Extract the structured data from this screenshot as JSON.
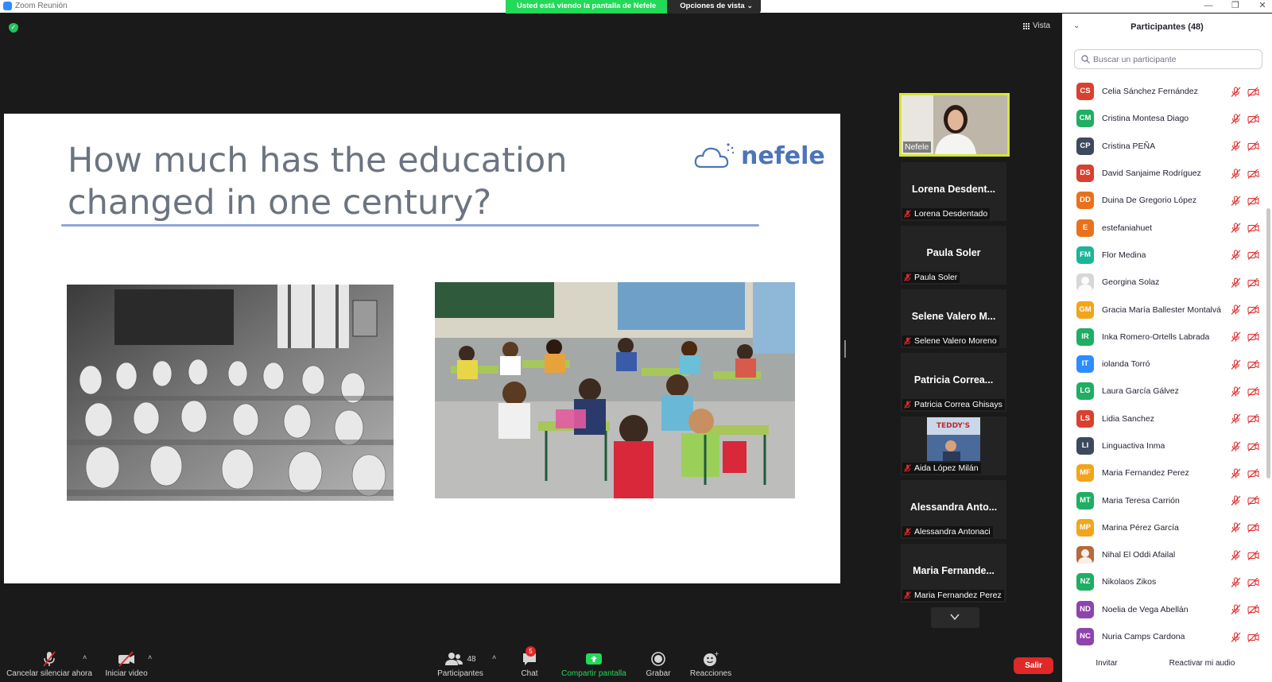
{
  "window": {
    "title": "Zoom Reunión",
    "controls": [
      "minimize",
      "restore",
      "close"
    ]
  },
  "share_banner": {
    "viewing_text": "Usted está viendo la pantalla de Nefele",
    "options_label": "Opciones de vista"
  },
  "view_button": {
    "label": "Vista"
  },
  "slide": {
    "title_line1": "How much has the education",
    "title_line2": "changed in one century?",
    "logo_text": "nefele"
  },
  "video_tiles": [
    {
      "big_name": "",
      "label": "Nefele",
      "has_video": true,
      "active_speaker": true
    },
    {
      "big_name": "Lorena Desdent...",
      "label": "Lorena Desdentado"
    },
    {
      "big_name": "Paula Soler",
      "label": "Paula Soler"
    },
    {
      "big_name": "Selene Valero M...",
      "label": "Selene Valero Moreno"
    },
    {
      "big_name": "Patricia Correa...",
      "label": "Patricia Correa Ghisays"
    },
    {
      "big_name": "",
      "label": "Aida López Milán",
      "has_video": true,
      "video_sign_text": "TEDDY'S"
    },
    {
      "big_name": "Alessandra Anto...",
      "label": "Alessandra Antonaci"
    },
    {
      "big_name": "Maria Fernande...",
      "label": "Maria Fernandez Perez"
    }
  ],
  "toolbar": {
    "unmute": "Cancelar silenciar ahora",
    "start_video": "Iniciar video",
    "participants": "Participantes",
    "participants_count": "48",
    "chat": "Chat",
    "chat_badge": "5",
    "share_screen": "Compartir pantalla",
    "record": "Grabar",
    "reactions": "Reacciones",
    "leave": "Salir"
  },
  "panel": {
    "title": "Participantes (48)",
    "search_placeholder": "Buscar un participante",
    "invite": "Invitar",
    "reactivate_audio": "Reactivar mi audio",
    "participants": [
      {
        "initials": "CS",
        "name": "Celia Sánchez Fernández",
        "color": "#d9402f"
      },
      {
        "initials": "CM",
        "name": "Cristina Montesa Diago",
        "color": "#1fae63"
      },
      {
        "initials": "CP",
        "name": "Cristina PEÑA",
        "color": "#3c4a5c"
      },
      {
        "initials": "DS",
        "name": "David Sanjaime Rodríguez",
        "color": "#d9402f"
      },
      {
        "initials": "DD",
        "name": "Duina De Gregorio López",
        "color": "#e8721b"
      },
      {
        "initials": "E",
        "name": "estefaniahuet",
        "color": "#e8721b"
      },
      {
        "initials": "FM",
        "name": "Flor Medina",
        "color": "#1cb598"
      },
      {
        "initials": "",
        "name": "Georgina Solaz",
        "color": "#d7d7d7",
        "photo": true
      },
      {
        "initials": "GM",
        "name": "Gracia María Ballester Montalvá",
        "color": "#f2a51c"
      },
      {
        "initials": "IR",
        "name": "Inka Romero-Ortells Labrada",
        "color": "#1fae63"
      },
      {
        "initials": "IT",
        "name": "iolanda Torró",
        "color": "#2d8cff"
      },
      {
        "initials": "LG",
        "name": "Laura García Gálvez",
        "color": "#1fae63"
      },
      {
        "initials": "LS",
        "name": "Lidia Sanchez",
        "color": "#d9402f"
      },
      {
        "initials": "LI",
        "name": "Linguactiva Inma",
        "color": "#3c4a5c"
      },
      {
        "initials": "MF",
        "name": "Maria Fernandez Perez",
        "color": "#f2a51c"
      },
      {
        "initials": "MT",
        "name": "Maria Teresa Carrión",
        "color": "#1fae63"
      },
      {
        "initials": "MP",
        "name": "Marina Pérez García",
        "color": "#f2a51c"
      },
      {
        "initials": "",
        "name": "Nihal El Oddi Afailal",
        "color": "#b66a3c",
        "photo": true
      },
      {
        "initials": "NZ",
        "name": "Nikolaos Zikos",
        "color": "#1fae63"
      },
      {
        "initials": "ND",
        "name": "Noelia de Vega Abellán",
        "color": "#8e44ad"
      },
      {
        "initials": "NC",
        "name": "Nuria Camps Cardona",
        "color": "#8e44ad"
      }
    ]
  },
  "colors": {
    "share_green": "#23d959",
    "leave_red": "#e02828",
    "speaker_border": "#d8e63a",
    "muted_red": "#e02828"
  }
}
